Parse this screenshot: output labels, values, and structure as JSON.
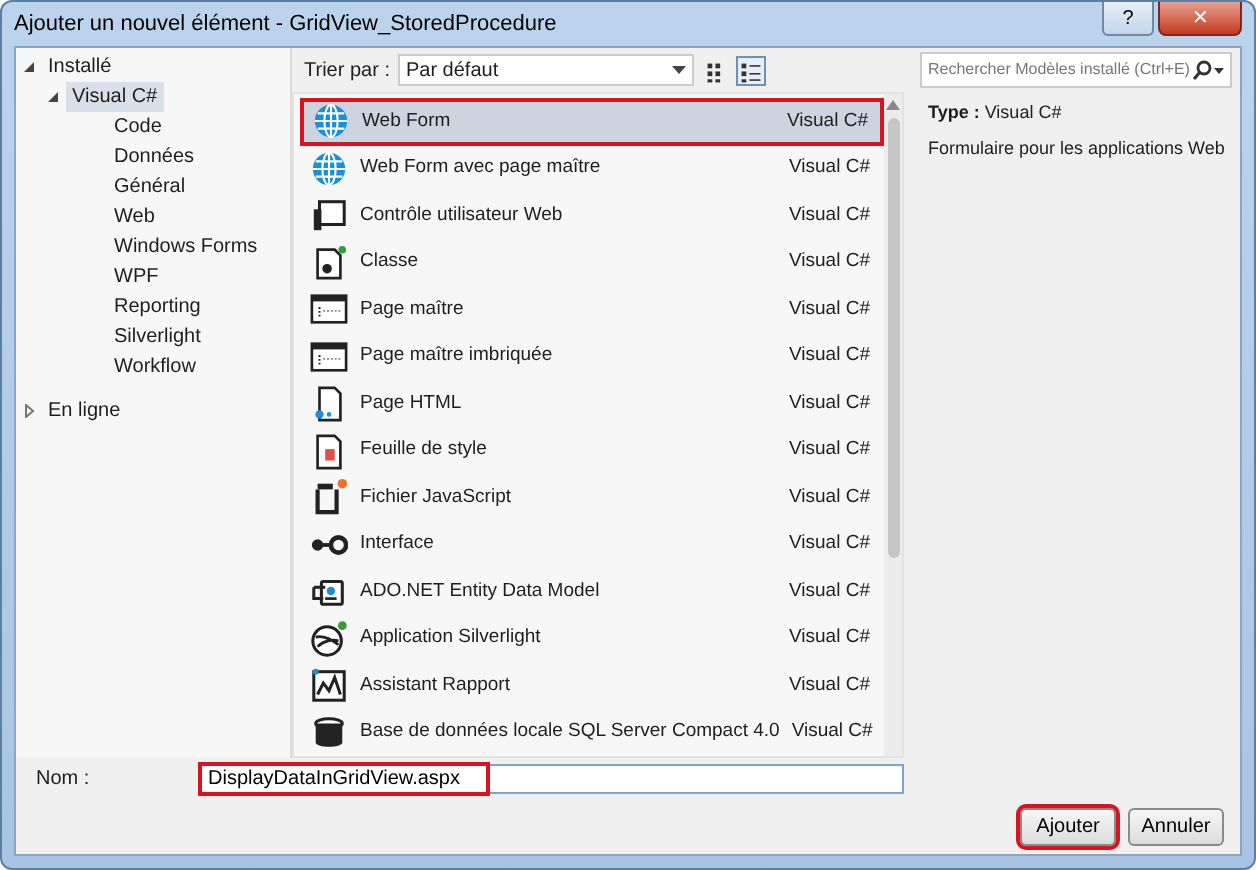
{
  "window": {
    "title": "Ajouter un nouvel élément - GridView_StoredProcedure",
    "help": "?",
    "close": "✕"
  },
  "tree": [
    {
      "label": "Installé",
      "expanded": true,
      "selected": false,
      "children": [
        {
          "label": "Visual C#",
          "expanded": true,
          "selected": true,
          "children": [
            {
              "label": "Code",
              "selected": false
            },
            {
              "label": "Données",
              "selected": false
            },
            {
              "label": "Général",
              "selected": false
            },
            {
              "label": "Web",
              "selected": false
            },
            {
              "label": "Windows Forms",
              "selected": false
            },
            {
              "label": "WPF",
              "selected": false
            },
            {
              "label": "Reporting",
              "selected": false
            },
            {
              "label": "Silverlight",
              "selected": false
            },
            {
              "label": "Workflow",
              "selected": false
            }
          ]
        }
      ]
    },
    {
      "label": "En ligne",
      "expanded": false,
      "selected": false
    }
  ],
  "toolbar": {
    "sort_label": "Trier par :",
    "sort_value": "Par défaut",
    "views": [
      {
        "kind": "grid",
        "selected": false
      },
      {
        "kind": "list",
        "selected": true
      }
    ]
  },
  "search": {
    "placeholder": "Rechercher Modèles installé (Ctrl+E)"
  },
  "templates": [
    {
      "kind": "globe",
      "name": "Web Form",
      "language": "Visual C#",
      "selected": true,
      "annotated": true
    },
    {
      "kind": "globe",
      "name": "Web Form avec page maître",
      "language": "Visual C#",
      "selected": false,
      "annotated": false
    },
    {
      "kind": "control",
      "name": "Contrôle utilisateur Web",
      "language": "Visual C#",
      "selected": false,
      "annotated": false
    },
    {
      "kind": "class",
      "name": "Classe",
      "language": "Visual C#",
      "selected": false,
      "annotated": false
    },
    {
      "kind": "master",
      "name": "Page maître",
      "language": "Visual C#",
      "selected": false,
      "annotated": false
    },
    {
      "kind": "master",
      "name": "Page maître imbriquée",
      "language": "Visual C#",
      "selected": false,
      "annotated": false
    },
    {
      "kind": "html",
      "name": "Page HTML",
      "language": "Visual C#",
      "selected": false,
      "annotated": false
    },
    {
      "kind": "css",
      "name": "Feuille de style",
      "language": "Visual C#",
      "selected": false,
      "annotated": false
    },
    {
      "kind": "js",
      "name": "Fichier JavaScript",
      "language": "Visual C#",
      "selected": false,
      "annotated": false
    },
    {
      "kind": "interface",
      "name": "Interface",
      "language": "Visual C#",
      "selected": false,
      "annotated": false
    },
    {
      "kind": "ado",
      "name": "ADO.NET Entity Data Model",
      "language": "Visual C#",
      "selected": false,
      "annotated": false
    },
    {
      "kind": "silverlight",
      "name": "Application Silverlight",
      "language": "Visual C#",
      "selected": false,
      "annotated": false
    },
    {
      "kind": "report",
      "name": "Assistant Rapport",
      "language": "Visual C#",
      "selected": false,
      "annotated": false
    },
    {
      "kind": "database",
      "name": "Base de données locale SQL Server Compact 4.0",
      "language": "Visual C#",
      "selected": false,
      "annotated": false
    }
  ],
  "details": {
    "type": "**Type :**  Visual C#",
    "description": "Formulaire pour les applications Web"
  },
  "name_field": {
    "label": "Nom :",
    "value": "DisplayDataInGridView.aspx",
    "annotated": true
  },
  "buttons": [
    {
      "label": "Ajouter",
      "annotated": true
    },
    {
      "label": "Annuler",
      "annotated": false
    }
  ]
}
